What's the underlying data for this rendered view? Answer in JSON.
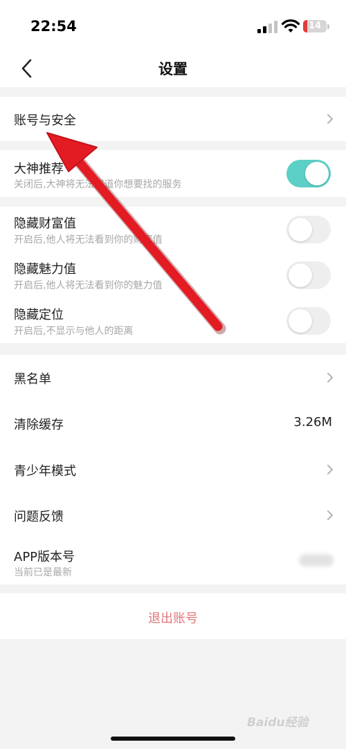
{
  "status_bar": {
    "time": "22:54",
    "battery": "14"
  },
  "nav": {
    "title": "设置"
  },
  "account": {
    "label": "账号与安全"
  },
  "recommend": {
    "title": "大神推荐",
    "desc": "关闭后,大神将无法知道你想要找的服务",
    "enabled": true
  },
  "privacy": [
    {
      "title": "隐藏财富值",
      "desc": "开启后,他人将无法看到你的财富值",
      "enabled": false
    },
    {
      "title": "隐藏魅力值",
      "desc": "开启后,他人将无法看到你的魅力值",
      "enabled": false
    },
    {
      "title": "隐藏定位",
      "desc": "开启后,不显示与他人的距离",
      "enabled": false
    }
  ],
  "general": {
    "blacklist": "黑名单",
    "clear_cache": "清除缓存",
    "cache_size": "3.26M",
    "youth_mode": "青少年模式",
    "feedback": "问题反馈",
    "app_version": "APP版本号",
    "version_status": "当前已是最新"
  },
  "logout": "退出账号",
  "watermark": "Baidu经验",
  "colors": {
    "accent": "#5ccfc7",
    "logout": "#e0777a",
    "annotation_arrow": "#e31b23"
  }
}
